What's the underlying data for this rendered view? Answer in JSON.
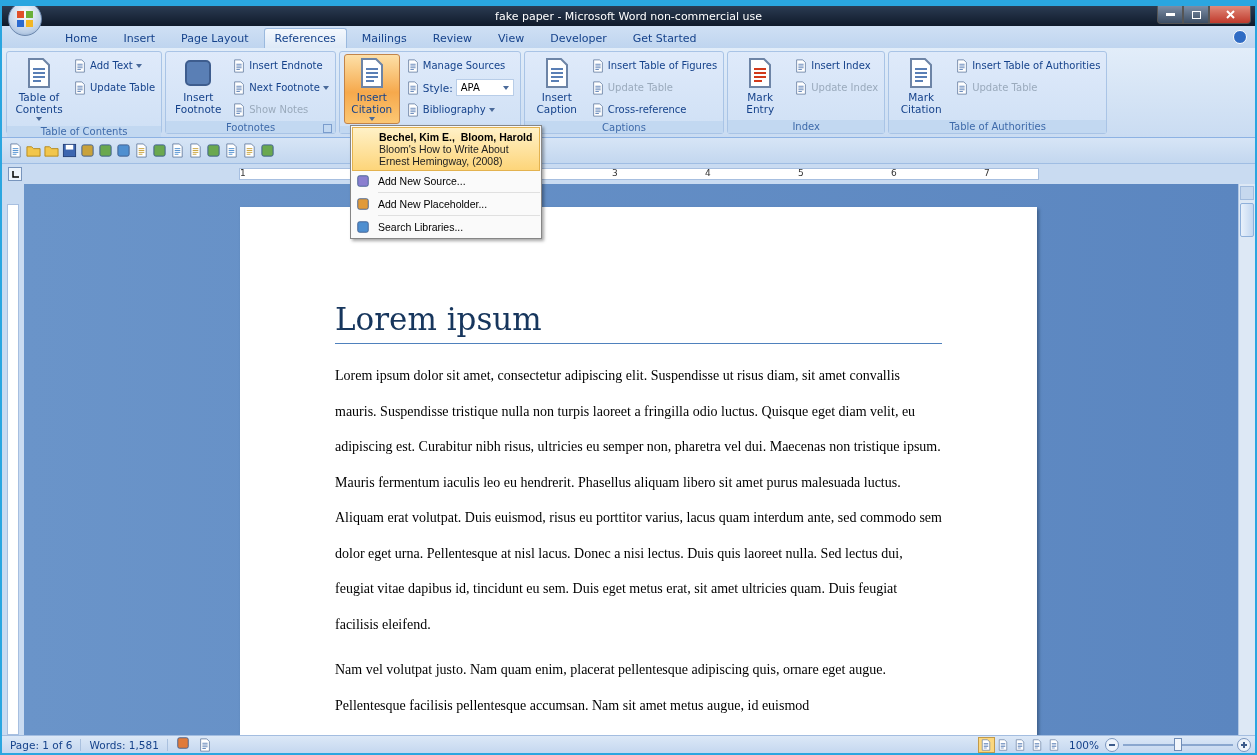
{
  "window": {
    "title": "fake paper - Microsoft Word non-commercial use"
  },
  "tabs": [
    {
      "label": "Home",
      "selected": false
    },
    {
      "label": "Insert",
      "selected": false
    },
    {
      "label": "Page Layout",
      "selected": false
    },
    {
      "label": "References",
      "selected": true
    },
    {
      "label": "Mailings",
      "selected": false
    },
    {
      "label": "Review",
      "selected": false
    },
    {
      "label": "View",
      "selected": false
    },
    {
      "label": "Developer",
      "selected": false
    },
    {
      "label": "Get Started",
      "selected": false
    }
  ],
  "ribbon_groups": [
    {
      "label": "Table of Contents",
      "large": {
        "label": "Table of Contents",
        "menu": true,
        "pressed": false
      },
      "items": [
        {
          "kind": "button",
          "label": "Add Text",
          "menu": true,
          "disabled": false
        },
        {
          "kind": "button",
          "label": "Update Table",
          "menu": false,
          "disabled": false
        }
      ]
    },
    {
      "label": "Footnotes",
      "launcher": true,
      "large": {
        "label": "Insert Footnote",
        "menu": false,
        "pressed": false
      },
      "items": [
        {
          "kind": "button",
          "label": "Insert Endnote",
          "menu": false,
          "disabled": false
        },
        {
          "kind": "button",
          "label": "Next Footnote",
          "menu": true,
          "disabled": false
        },
        {
          "kind": "button",
          "label": "Show Notes",
          "menu": false,
          "disabled": true
        }
      ]
    },
    {
      "large": {
        "label": "Insert Citation",
        "menu": true,
        "pressed": true
      },
      "items": [
        {
          "kind": "button",
          "label": "Manage Sources",
          "menu": false,
          "disabled": false
        },
        {
          "kind": "select",
          "label": "Style:",
          "value": "APA"
        },
        {
          "kind": "button",
          "label": "Bibliography",
          "menu": true,
          "disabled": false
        }
      ]
    },
    {
      "label": "Captions",
      "large": {
        "label": "Insert Caption",
        "menu": false,
        "pressed": false
      },
      "items": [
        {
          "kind": "button",
          "label": "Insert Table of Figures",
          "menu": false,
          "disabled": false
        },
        {
          "kind": "button",
          "label": "Update Table",
          "menu": false,
          "disabled": true
        },
        {
          "kind": "button",
          "label": "Cross-reference",
          "menu": false,
          "disabled": false
        }
      ]
    },
    {
      "label": "Index",
      "large": {
        "label": "Mark Entry",
        "menu": false,
        "pressed": false
      },
      "items": [
        {
          "kind": "button",
          "label": "Insert Index",
          "menu": false,
          "disabled": false
        },
        {
          "kind": "button",
          "label": "Update Index",
          "menu": false,
          "disabled": true
        }
      ]
    },
    {
      "label": "Table of Authorities",
      "large": {
        "label": "Mark Citation",
        "menu": false,
        "pressed": false
      },
      "items": [
        {
          "kind": "button",
          "label": "Insert Table of Authorities",
          "menu": false,
          "disabled": false
        },
        {
          "kind": "button",
          "label": "Update Table",
          "menu": false,
          "disabled": true
        }
      ]
    }
  ],
  "citation_menu": {
    "sources": [
      {
        "author": "Bechel, Kim E.,  Bloom, Harold",
        "title": "Bloom's How to Write About Ernest Hemingway, (2008)",
        "selected": true
      }
    ],
    "items": [
      "Add New Source...",
      "Add New Placeholder...",
      "Search Libraries..."
    ]
  },
  "ruler": {
    "numbers": [
      "1",
      "3",
      "4",
      "5",
      "6",
      "7"
    ]
  },
  "document": {
    "heading": "Lorem ipsum",
    "paragraphs": [
      "Lorem ipsum dolor sit amet, consectetur adipiscing elit. Suspendisse ut risus diam, sit amet convallis mauris. Suspendisse tristique nulla non turpis laoreet a fringilla odio luctus. Quisque eget diam velit, eu adipiscing est. Curabitur nibh risus, ultricies eu semper non, pharetra vel dui. Maecenas non tristique ipsum. Mauris fermentum iaculis leo eu hendrerit. Phasellus aliquam libero sit amet purus malesuada luctus. Aliquam erat volutpat. Duis euismod, risus eu porttitor varius, lacus quam interdum ante, sed commodo sem dolor eget urna. Pellentesque at nisl lacus. Donec a nisi lectus. Duis quis laoreet nulla. Sed lectus dui, feugiat vitae dapibus id, tincidunt eu sem. Duis eget metus erat, sit amet ultricies quam. Duis feugiat facilisis eleifend.",
      "Nam vel volutpat justo. Nam quam enim, placerat pellentesque adipiscing quis, ornare eget augue. Pellentesque facilisis pellentesque accumsan. Nam sit amet metus augue, id euismod"
    ]
  },
  "status_bar": {
    "page": "Page: 1 of 6",
    "words": "Words: 1,581",
    "views": [
      {
        "selected": true
      },
      {
        "selected": false
      },
      {
        "selected": false
      },
      {
        "selected": false
      },
      {
        "selected": false
      }
    ],
    "zoom": {
      "reading": "100%",
      "level": 0.5
    }
  }
}
